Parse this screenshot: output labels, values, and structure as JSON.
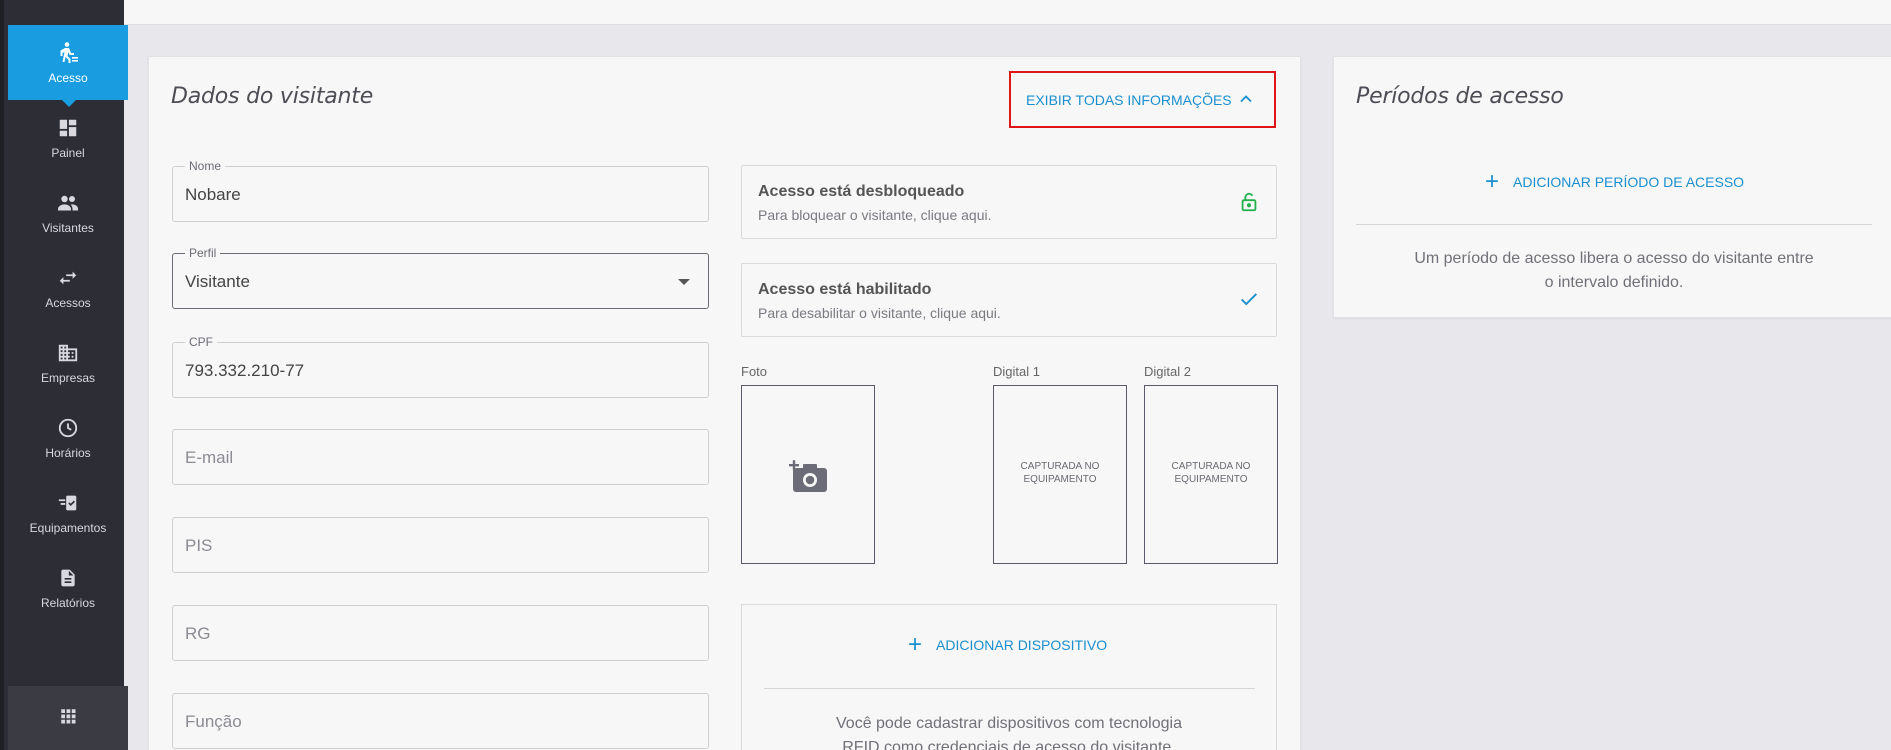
{
  "sidebar": {
    "items": [
      {
        "label": "Acesso",
        "icon": "person-walking-icon"
      },
      {
        "label": "Painel",
        "icon": "dashboard-icon"
      },
      {
        "label": "Visitantes",
        "icon": "people-icon"
      },
      {
        "label": "Acessos",
        "icon": "swap-arrows-icon"
      },
      {
        "label": "Empresas",
        "icon": "building-icon"
      },
      {
        "label": "Horários",
        "icon": "clock-icon"
      },
      {
        "label": "Equipamentos",
        "icon": "device-icon"
      },
      {
        "label": "Relatórios",
        "icon": "report-icon"
      }
    ],
    "bottom_icon": "apps-grid-icon"
  },
  "visitor": {
    "title": "Dados do visitante",
    "toggle_label": "EXIBIR TODAS INFORMAÇÕES",
    "fields": {
      "nome": {
        "label": "Nome",
        "value": "Nobare"
      },
      "perfil": {
        "label": "Perfil",
        "value": "Visitante"
      },
      "cpf": {
        "label": "CPF",
        "value": "793.332.210-77"
      },
      "email": {
        "placeholder": "E-mail"
      },
      "pis": {
        "placeholder": "PIS"
      },
      "rg": {
        "placeholder": "RG"
      },
      "funcao": {
        "placeholder": "Função"
      }
    },
    "status": {
      "blocked": {
        "title": "Acesso está desbloqueado",
        "subtitle": "Para bloquear o visitante, clique aqui."
      },
      "enabled": {
        "title": "Acesso está habilitado",
        "subtitle": "Para desabilitar o visitante, clique aqui."
      }
    },
    "media": {
      "foto_label": "Foto",
      "digital1_label": "Digital 1",
      "digital2_label": "Digital 2",
      "digital_caption_line1": "CAPTURADA NO",
      "digital_caption_line2": "EQUIPAMENTO"
    },
    "device": {
      "add_label": "ADICIONAR DISPOSITIVO",
      "help_line1": "Você pode cadastrar dispositivos com tecnologia",
      "help_line2": "RFID como credenciais de acesso do visitante."
    }
  },
  "periods": {
    "title": "Períodos de acesso",
    "add_label": "ADICIONAR PERÍODO DE ACESSO",
    "help_line1": "Um período de acesso libera o acesso do visitante entre",
    "help_line2": "o intervalo definido."
  },
  "colors": {
    "accent": "#1a9de0",
    "link": "#1a8fcf",
    "sidebar_bg": "#2c2d35",
    "highlight_border": "#e01515",
    "unlock_green": "#22b04a"
  }
}
